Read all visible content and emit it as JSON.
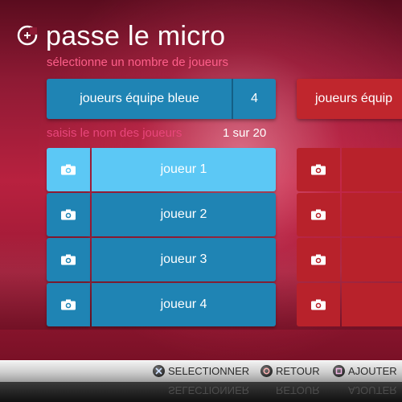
{
  "header": {
    "title": "passe le micro",
    "subtitle": "sélectionne un nombre de joueurs",
    "logo_icon": "microphone-plus-icon"
  },
  "team_blue": {
    "name": "joueurs équipe bleue",
    "count": "4",
    "color": "#1f84b4"
  },
  "team_red": {
    "name_partial": "joueurs équip",
    "color": "#c0262d"
  },
  "player_entry": {
    "label": "saisis le nom des joueurs",
    "counter": "1 sur 20"
  },
  "players_blue": [
    {
      "name": "joueur 1",
      "active": true
    },
    {
      "name": "joueur 2",
      "active": false
    },
    {
      "name": "joueur 3",
      "active": false
    },
    {
      "name": "joueur 4",
      "active": false
    }
  ],
  "footer": {
    "select_label": "SELECTIONNER",
    "back_label": "RETOUR",
    "add_label": "AJOUTER",
    "select_icon": "cross-button-icon",
    "back_icon": "circle-button-icon",
    "add_icon": "square-button-icon"
  },
  "colors": {
    "active_row": "#5cc8f5",
    "accent_pink": "#ff5f8a"
  }
}
